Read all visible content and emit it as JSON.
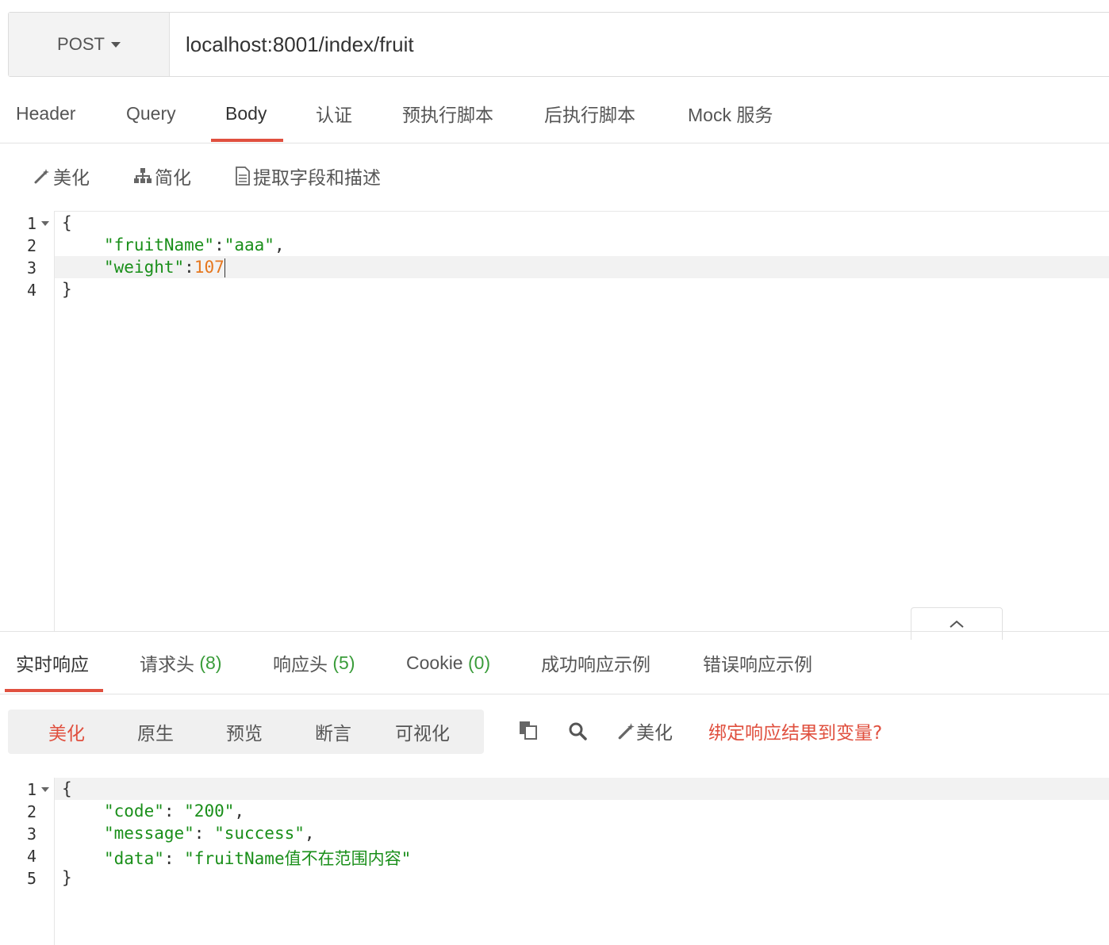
{
  "request": {
    "method": "POST",
    "url": "localhost:8001/index/fruit"
  },
  "request_tabs": [
    "Header",
    "Query",
    "Body",
    "认证",
    "预执行脚本",
    "后执行脚本",
    "Mock 服务"
  ],
  "active_request_tab": "Body",
  "body_toolbar": {
    "beautify": "美化",
    "simplify": "简化",
    "extract": "提取字段和描述"
  },
  "request_body": {
    "line_numbers": [
      "1",
      "2",
      "3",
      "4"
    ],
    "open_brace": "{",
    "line2_key": "\"fruitName\"",
    "line2_colon": ":",
    "line2_value": "\"aaa\"",
    "line2_comma": ",",
    "line3_key": "\"weight\"",
    "line3_colon": ":",
    "line3_value": "107",
    "close_brace": "}"
  },
  "response_tabs": {
    "realtime": "实时响应",
    "req_headers": "请求头",
    "req_headers_count": "(8)",
    "resp_headers": "响应头",
    "resp_headers_count": "(5)",
    "cookie": "Cookie",
    "cookie_count": "(0)",
    "success_example": "成功响应示例",
    "error_example": "错误响应示例"
  },
  "active_response_tab": "实时响应",
  "response_view": {
    "modes": [
      "美化",
      "原生",
      "预览",
      "断言",
      "可视化"
    ],
    "active_mode": "美化",
    "beautify": "美化",
    "bind_link": "绑定响应结果到变量?"
  },
  "response_body": {
    "line_numbers": [
      "1",
      "2",
      "3",
      "4",
      "5"
    ],
    "open_brace": "{",
    "code_key": "\"code\"",
    "code_value": "\"200\"",
    "message_key": "\"message\"",
    "message_value": "\"success\"",
    "data_key": "\"data\"",
    "data_value": "\"fruitName值不在范围内容\"",
    "colon": ": ",
    "comma": ",",
    "close_brace": "}"
  },
  "colors": {
    "accent": "#e0503f",
    "json_string": "#1a8f1a",
    "json_number": "#e6771e",
    "count": "#3a9c3a"
  }
}
